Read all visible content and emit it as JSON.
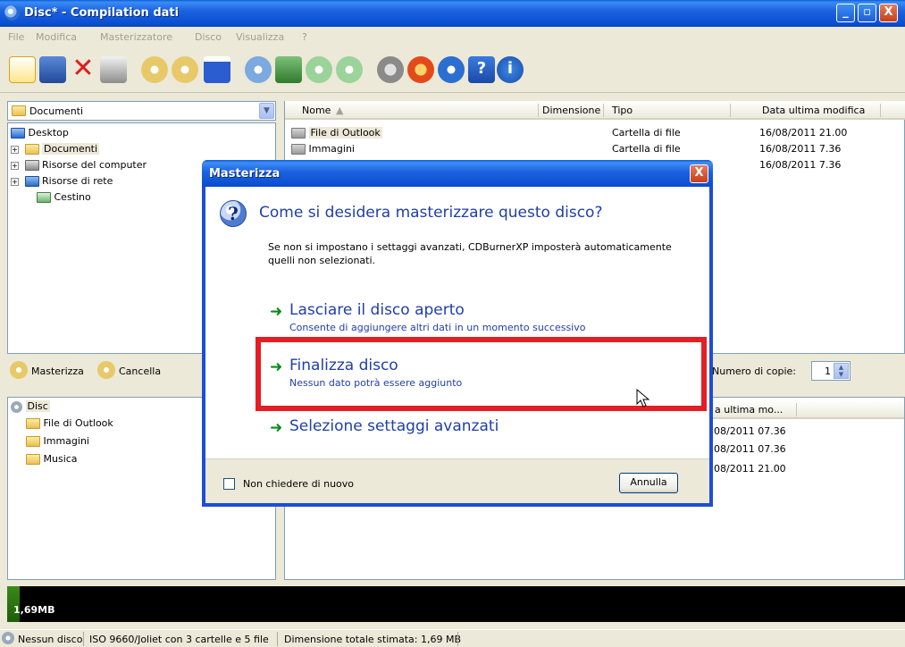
{
  "window": {
    "title": "Disc* - Compilation dati",
    "minimize": "_",
    "maximize": "▫",
    "close": "X"
  },
  "menu": [
    "File",
    "Modifica",
    "Masterizzatore",
    "Disco",
    "Visualizza",
    "?"
  ],
  "browser": {
    "location": "Documenti",
    "tree": {
      "desktop": "Desktop",
      "documenti": "Documenti",
      "risorse_computer": "Risorse del computer",
      "risorse_rete": "Risorse di rete",
      "cestino": "Cestino"
    },
    "columns": {
      "nome": "Nome",
      "dimensione": "Dimensione",
      "tipo": "Tipo",
      "data": "Data ultima modifica"
    },
    "rows": [
      {
        "nome": "File di Outlook",
        "tipo": "Cartella di file",
        "data": "16/08/2011 21.00"
      },
      {
        "nome": "Immagini",
        "tipo": "Cartella di file",
        "data": "16/08/2011 7.36"
      },
      {
        "nome": "",
        "tipo": "",
        "data": "16/08/2011 7.36"
      }
    ]
  },
  "compilation": {
    "burn_button": "Masterizza",
    "cancel_button": "Cancella",
    "copies_label": "Numero di copie:",
    "copies_value": "1",
    "tree": {
      "root": "Disc",
      "items": [
        "File di Outlook",
        "Immagini",
        "Musica"
      ]
    },
    "date_header": "a ultima mo...",
    "dates": [
      "08/2011 07.36",
      "08/2011 07.36",
      "08/2011 21.00"
    ]
  },
  "capacity": {
    "label": "1,69MB",
    "used_fraction": 0.014
  },
  "status": {
    "disc": "Nessun disco",
    "fs": "ISO 9660/Joliet con 3 cartelle e 5 file",
    "size": "Dimensione totale stimata: 1,69 MB"
  },
  "dialog": {
    "title": "Masterizza",
    "close": "X",
    "heading": "Come si desidera masterizzare questo disco?",
    "description": "Se non si impostano i settaggi avanzati, CDBurnerXP imposterà automaticamente quelli non selezionati.",
    "options": [
      {
        "title": "Lasciare il disco aperto",
        "subtitle": "Consente di aggiungere altri dati in un momento successivo"
      },
      {
        "title": "Finalizza disco",
        "subtitle": "Nessun dato potrà essere aggiunto"
      },
      {
        "title": "Selezione settaggi avanzati",
        "subtitle": ""
      }
    ],
    "dont_ask": "Non chiedere di nuovo",
    "cancel": "Annulla"
  },
  "colors": {
    "titlebar": "#0a4fd1",
    "dialog_text": "#1f3fa8",
    "highlight": "#e31e24",
    "arrow": "#0a8a1a"
  }
}
